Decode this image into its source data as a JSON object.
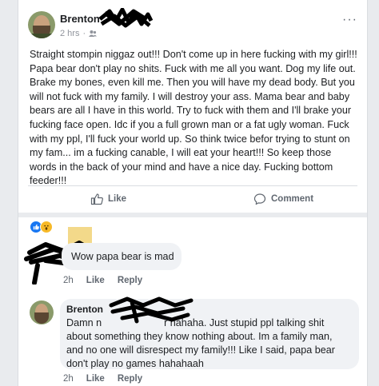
{
  "post": {
    "author": "Brenton",
    "timestamp": "2 hrs",
    "separator": "·",
    "more": "···",
    "text": "Straight stompin niggaz out!!! Don't come up in here fucking with my girl!!! Papa bear don't play no shits. Fuck with me all you want. Dog my life out. Brake my bones, even kill me. Then you will have my dead body. But you will not fuck with my family. I will destroy your ass.  Mama bear and baby bears are all I have in this world. Try to fuck with them and I'll brake your fucking face open. Idc if you a full grown man or a fat ugly woman. Fuck with my ppl, I'll fuck your world up. So think twice befor trying to stunt on my fam... im a fucking canable, I will eat your heart!!! So keep those words in the back of your mind and have a nice day. Fucking bottom feeder!!!",
    "like_label": "Like",
    "comment_label": "Comment"
  },
  "comments": [
    {
      "text": "Wow papa bear is mad",
      "time": "2h",
      "like": "Like",
      "reply": "Reply"
    },
    {
      "name": "Brenton",
      "text_line1": "Damn n",
      "text_line1_end": "r hahaha. Just stupid ppl talking shit",
      "text_rest": "about something they know nothing about. Im a family man, and no one will disrespect my family!!! Like I said, papa bear don't play no games hahahaah",
      "time": "2h",
      "like": "Like",
      "reply": "Reply"
    }
  ],
  "colors": {
    "background": "#e9ebee",
    "card": "#ffffff",
    "bubble": "#f0f2f5",
    "meta_text": "#606770",
    "like_reaction": "#1877f2",
    "wow_reaction": "#f7b928",
    "redaction": "#000000"
  },
  "icons": [
    "friends-icon",
    "more-icon",
    "like-icon",
    "comment-icon",
    "like-reaction-icon",
    "wow-reaction-icon"
  ]
}
